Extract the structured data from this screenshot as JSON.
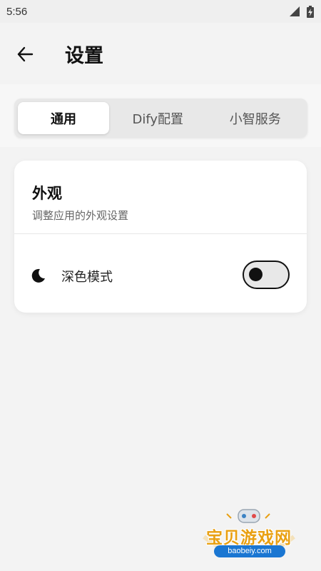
{
  "status_bar": {
    "time": "5:56"
  },
  "app_bar": {
    "title": "设置",
    "back_icon": "arrow-left-icon"
  },
  "tabs": [
    {
      "label": "通用",
      "active": true
    },
    {
      "label": "Dify配置",
      "active": false
    },
    {
      "label": "小智服务",
      "active": false
    }
  ],
  "appearance_card": {
    "title": "外观",
    "subtitle": "调整应用的外观设置",
    "dark_mode": {
      "label": "深色模式",
      "icon": "moon-icon",
      "enabled": false
    }
  },
  "watermark": {
    "text": "宝贝游戏网",
    "url": "baobeiy.com"
  },
  "colors": {
    "background": "#f3f3f3",
    "card": "#ffffff",
    "toggle_border": "#111111",
    "watermark_text": "#e9a012",
    "watermark_badge": "#1a76d2"
  }
}
